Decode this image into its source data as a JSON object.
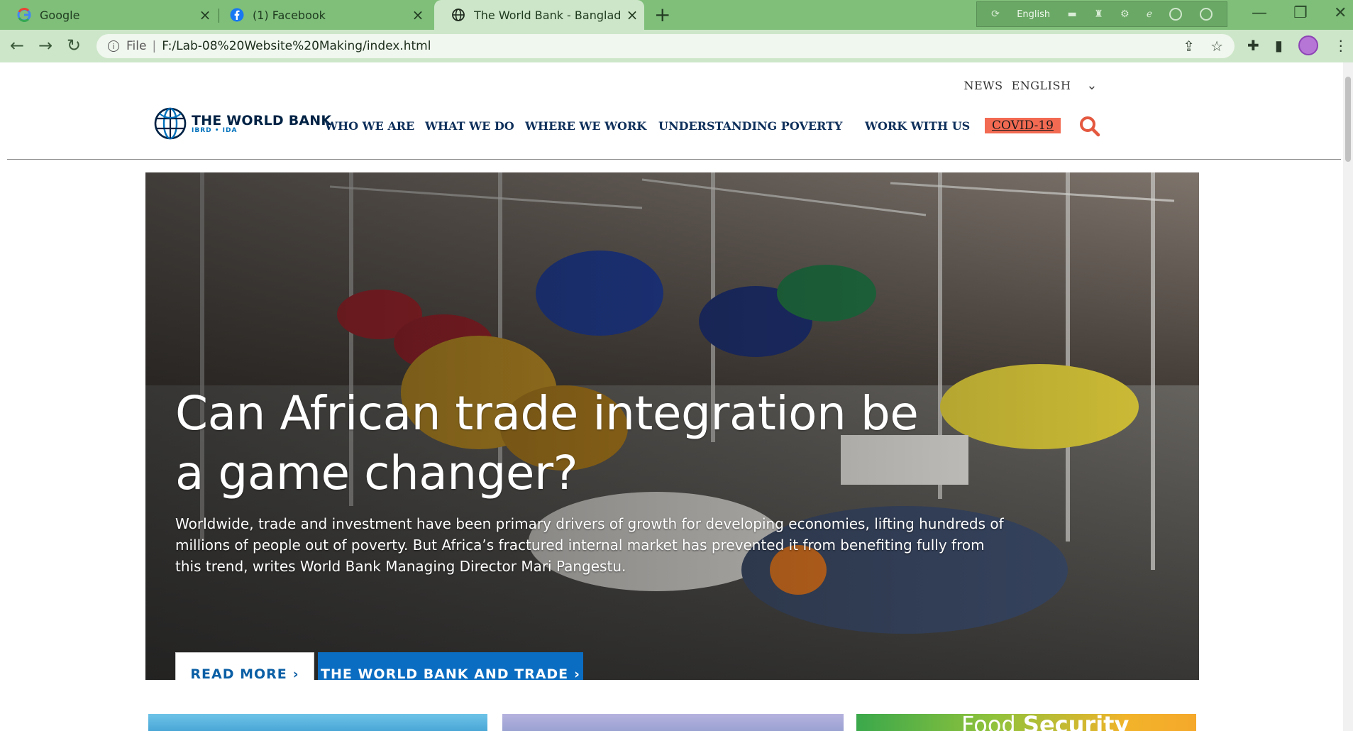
{
  "browser": {
    "tabs": [
      {
        "title": "Google",
        "active": false
      },
      {
        "title": "(1) Facebook",
        "active": false
      },
      {
        "title": "The World Bank - Bangladesh",
        "active": true
      }
    ],
    "extension_language": "English",
    "address": {
      "scheme_label": "File",
      "url": "F:/Lab-08%20Website%20Making/index.html"
    }
  },
  "site": {
    "utility_nav": {
      "news": "NEWS",
      "language": "ENGLISH"
    },
    "logo": {
      "main": "THE WORLD BANK",
      "sub": "IBRD • IDA"
    },
    "main_nav": [
      "WHO WE ARE",
      "WHAT WE DO",
      "WHERE WE WORK",
      "UNDERSTANDING POVERTY",
      "WORK WITH US",
      "COVID-19"
    ],
    "hero": {
      "title": "Can African trade integration be a game changer?",
      "text": "Worldwide, trade and investment have been primary drivers of growth for developing economies, lifting hundreds of millions of people out of poverty. But Africa’s fractured internal market has prevented it from benefiting fully from this trend, writes World Bank Managing Director Mari Pangestu.",
      "read_more": "READ MORE",
      "trade_button": "THE WORLD BANK AND TRADE"
    },
    "cards": {
      "food_title_light": "Food",
      "food_title_bold": "Security"
    }
  },
  "colors": {
    "tabstrip": "#7fbf7a",
    "toolbar": "#cde6c9",
    "nav_text": "#0e2f5a",
    "covid_bg": "#f26a52",
    "search_icon": "#e4583f",
    "primary_button": "#0b6dc1"
  }
}
